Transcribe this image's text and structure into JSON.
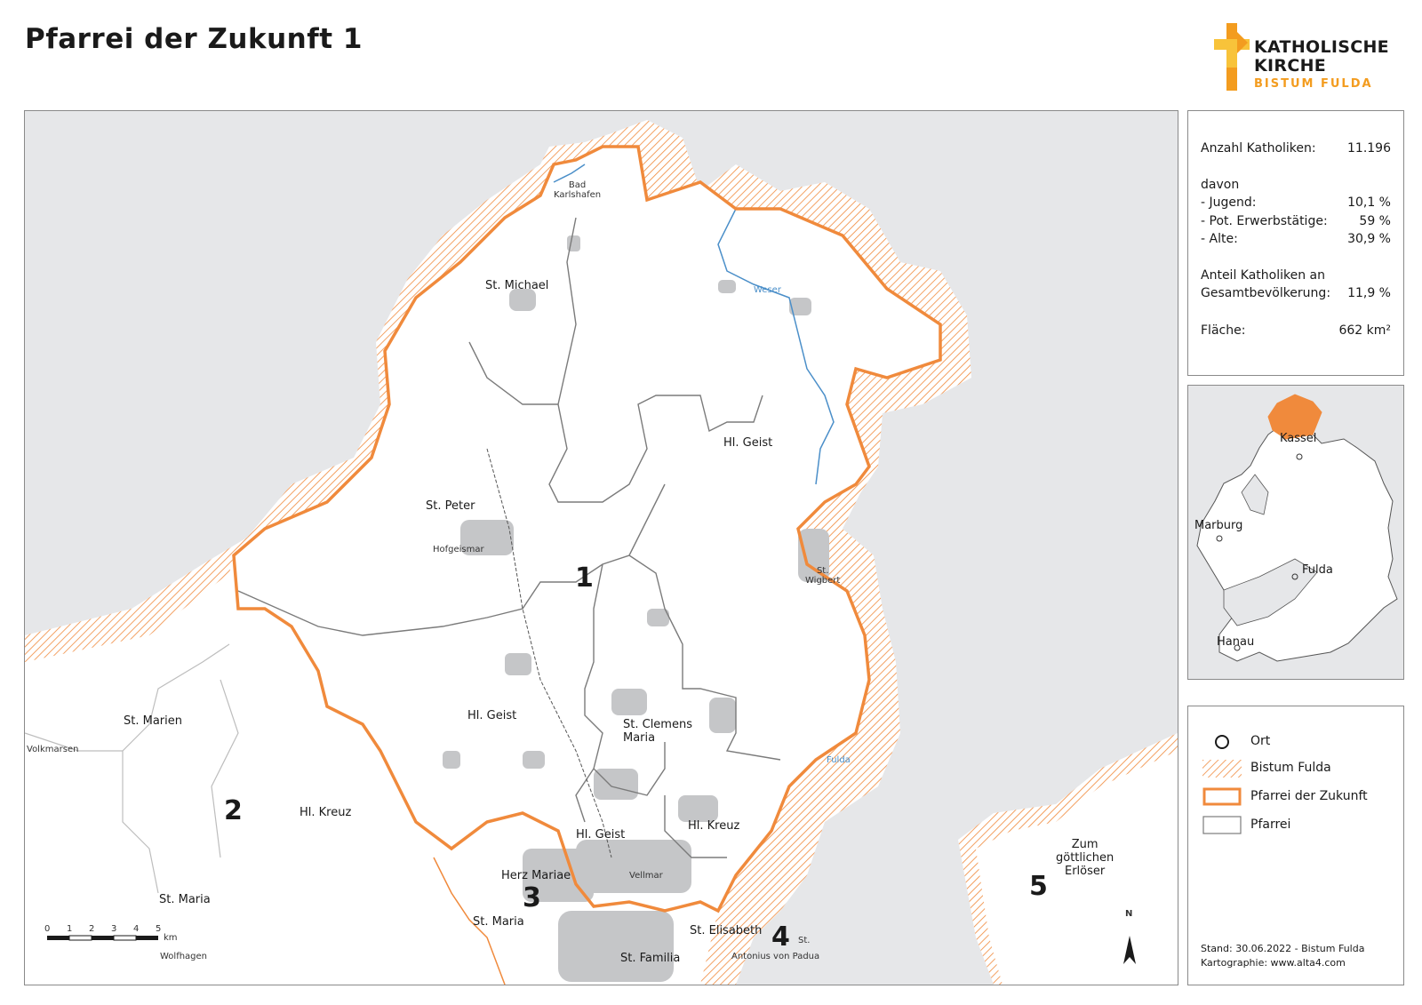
{
  "title": "Pfarrei der Zukunft 1",
  "logo": {
    "line1": "KATHOLISCHE",
    "line2": "KIRCHE",
    "line3": "BISTUM FULDA",
    "colors": {
      "orange": "#f39c1f",
      "yellow": "#f8c33a",
      "dark": "#1a1a1a"
    }
  },
  "colors": {
    "boundary_orange": "#f08a3c",
    "land_white": "#ffffff",
    "outside_gray": "#e6e7e9",
    "settlement_gray": "#c5c6c8",
    "river_blue": "#4b8fc9"
  },
  "stats": {
    "katholiken_label": "Anzahl Katholiken:",
    "katholiken_value": "11.196",
    "davon_label": "davon",
    "jugend_label": "- Jugend:",
    "jugend_value": "10,1 %",
    "erwerb_label": "- Pot. Erwerbstätige:",
    "erwerb_value": "59 %",
    "alte_label": "- Alte:",
    "alte_value": "30,9 %",
    "anteil_label1": "Anteil Katholiken an",
    "anteil_label2": "Gesamtbevölkerung:",
    "anteil_value": "11,9 %",
    "flaeche_label": "Fläche:",
    "flaeche_value": "662 km²"
  },
  "inset": {
    "kassel": "Kassel",
    "marburg": "Marburg",
    "fulda": "Fulda",
    "hanau": "Hanau"
  },
  "legend": {
    "ort": "Ort",
    "bistum": "Bistum Fulda",
    "pfarrei_zukunft": "Pfarrei der Zukunft",
    "pfarrei": "Pfarrei",
    "stand": "Stand: 30.06.2022 - Bistum Fulda",
    "kartographie": "Kartographie: www.alta4.com"
  },
  "map": {
    "bad_karlshafen": "Bad\nKarlshafen",
    "hofgeismar": "Hofgeismar",
    "volkmarsen": "Volkmarsen",
    "wolfhagen": "Wolfhagen",
    "vellmar": "Vellmar",
    "weser": "Weser",
    "fulda_river": "Fulda",
    "st_michael": "St. Michael",
    "st_peter": "St. Peter",
    "hl_geist_ne": "Hl. Geist",
    "st_wigbert": "St.\nWigbert",
    "hl_geist_c": "Hl. Geist",
    "st_clemens": "St. Clemens\nMaria",
    "hl_geist_s": "Hl. Geist",
    "hl_kreuz_s": "Hl. Kreuz",
    "herz_mariae": "Herz Mariae",
    "st_maria_s": "St. Maria",
    "st_elisabeth": "St. Elisabeth",
    "st_familia": "St. Familia",
    "antonius": "Antonius von Padua",
    "st_small": "St.",
    "st_marien": "St. Marien",
    "hl_kreuz_w": "Hl. Kreuz",
    "st_maria_w": "St. Maria",
    "zum": "Zum\ngöttlichen\nErlöser",
    "n1": "1",
    "n2": "2",
    "n3": "3",
    "n4": "4",
    "n5": "5",
    "north": "N",
    "scale_ticks": [
      "0",
      "1",
      "2",
      "3",
      "4",
      "5"
    ],
    "scale_unit": "km"
  }
}
